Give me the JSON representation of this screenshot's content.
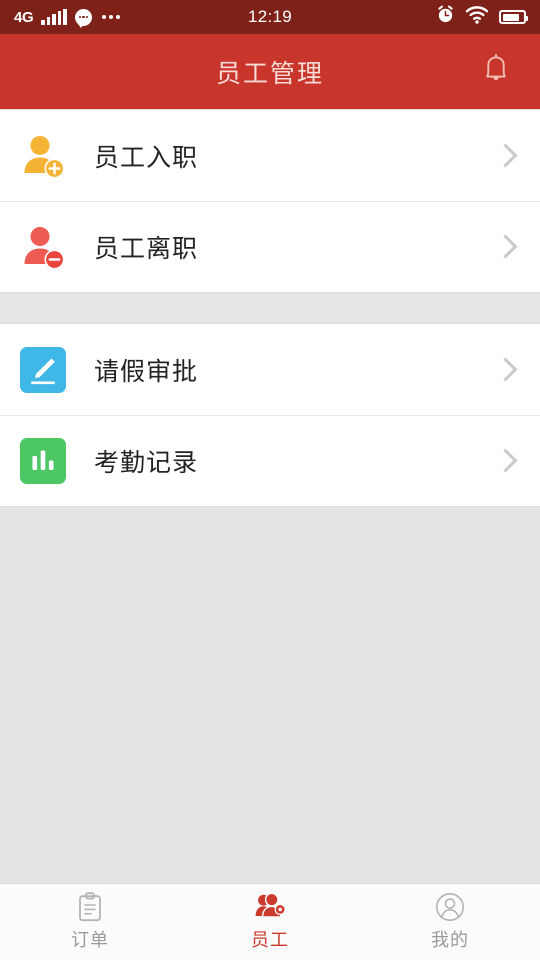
{
  "status_bar": {
    "network_label": "4G",
    "time": "12:19",
    "signal_icon": "signal-bars-icon",
    "chat_icon": "chat-bubble-icon",
    "more_icon": "more-dots-icon",
    "alarm_icon": "alarm-clock-icon",
    "wifi_icon": "wifi-icon",
    "battery_icon": "battery-icon",
    "background_color": "#7e2119"
  },
  "header": {
    "title": "员工管理",
    "bell_icon": "bell-icon",
    "background_color": "#c8352a",
    "title_color": "#f7dcd8"
  },
  "list": {
    "groups": [
      {
        "rows": [
          {
            "label": "员工入职",
            "icon": "user-add-icon",
            "icon_color": "#f5b335",
            "chevron": "chevron-right-icon"
          },
          {
            "label": "员工离职",
            "icon": "user-remove-icon",
            "icon_color": "#ee5b52",
            "chevron": "chevron-right-icon"
          }
        ]
      },
      {
        "rows": [
          {
            "label": "请假审批",
            "icon": "edit-pencil-icon",
            "icon_color": "#3fb8e8",
            "chevron": "chevron-right-icon"
          },
          {
            "label": "考勤记录",
            "icon": "bar-chart-icon",
            "icon_color": "#4cc764",
            "chevron": "chevron-right-icon"
          }
        ]
      }
    ]
  },
  "tab_bar": {
    "active_color": "#cc3a2e",
    "inactive_color": "#9a9a9a",
    "tabs": [
      {
        "label": "订单",
        "icon": "clipboard-icon",
        "active": false
      },
      {
        "label": "员工",
        "icon": "people-gear-icon",
        "active": true
      },
      {
        "label": "我的",
        "icon": "person-circle-icon",
        "active": false
      }
    ]
  }
}
